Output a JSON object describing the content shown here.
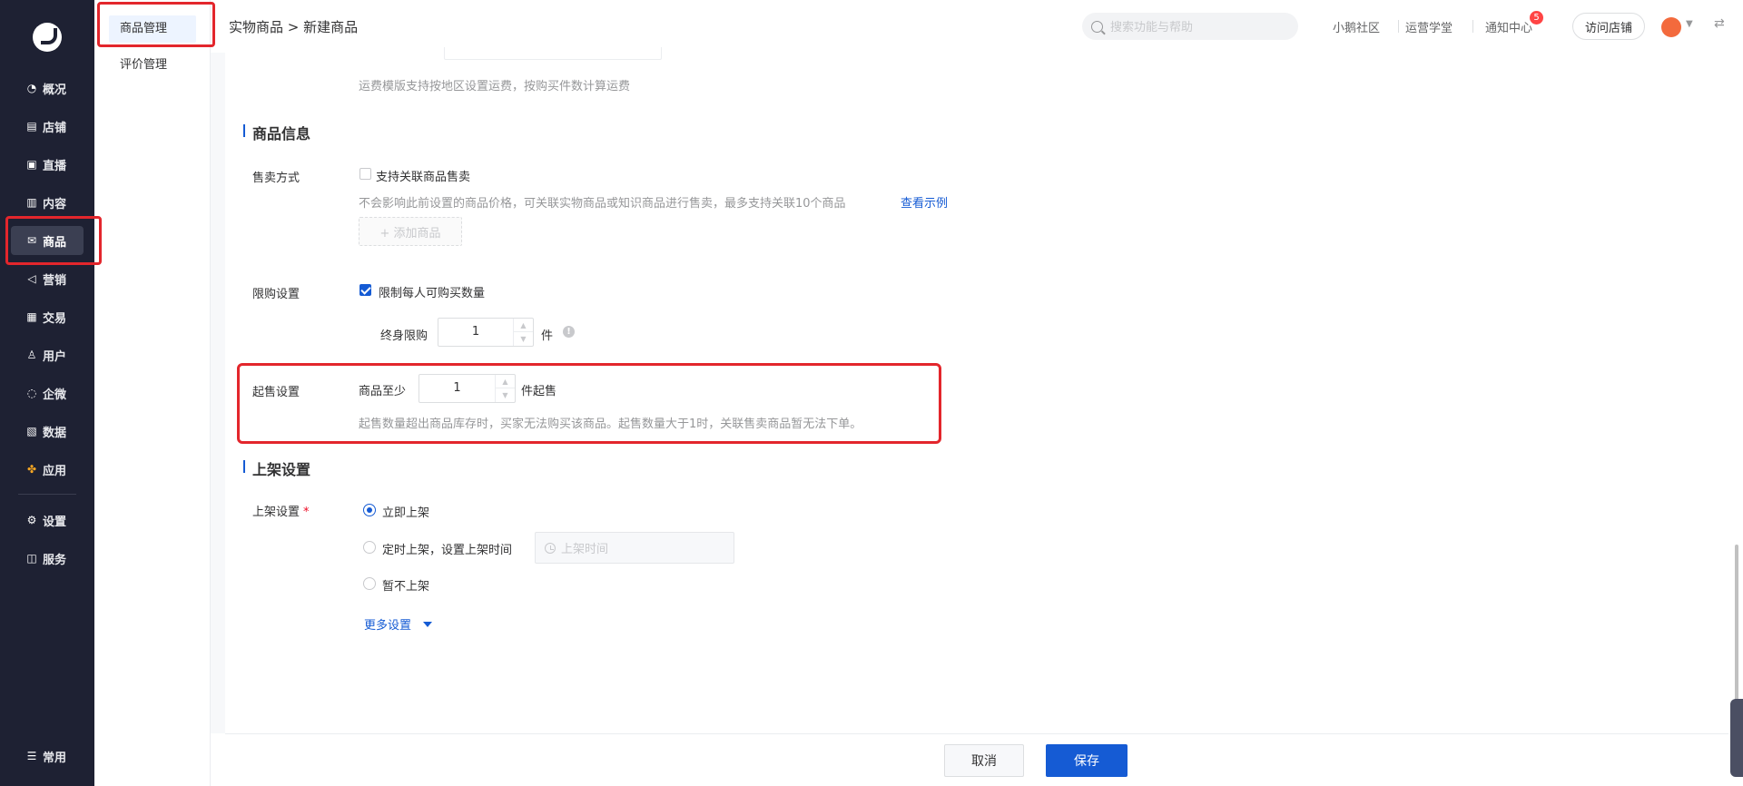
{
  "sidebar": {
    "items": [
      {
        "label": "概况",
        "icon": "pie-chart-icon"
      },
      {
        "label": "店铺",
        "icon": "store-icon"
      },
      {
        "label": "直播",
        "icon": "live-icon"
      },
      {
        "label": "内容",
        "icon": "document-icon"
      },
      {
        "label": "商品",
        "icon": "goods-icon"
      },
      {
        "label": "营销",
        "icon": "megaphone-icon"
      },
      {
        "label": "交易",
        "icon": "transaction-icon"
      },
      {
        "label": "用户",
        "icon": "user-icon"
      },
      {
        "label": "企微",
        "icon": "wecom-icon"
      },
      {
        "label": "数据",
        "icon": "data-icon"
      },
      {
        "label": "应用",
        "icon": "apps-icon"
      },
      {
        "label": "设置",
        "icon": "gear-icon"
      },
      {
        "label": "服务",
        "icon": "service-icon"
      },
      {
        "label": "常用",
        "icon": "list-icon"
      }
    ],
    "active": "商品"
  },
  "submenu": {
    "items": [
      {
        "label": "商品管理"
      },
      {
        "label": "评价管理"
      }
    ]
  },
  "header": {
    "breadcrumb": "实物商品 > 新建商品",
    "search_placeholder": "搜索功能与帮助",
    "links": {
      "community": "小鹅社区",
      "academy": "运营学堂",
      "notifications": "通知中心"
    },
    "notification_count": "5",
    "visit_store": "访问店铺"
  },
  "form": {
    "shipping_help": "运费模版支持按地区设置运费，按购买件数计算运费",
    "product_info": {
      "title": "商品信息",
      "sale_method": {
        "label": "售卖方式",
        "checkbox_label": "支持关联商品售卖",
        "checked": false,
        "help": "不会影响此前设置的商品价格，可关联实物商品或知识商品进行售卖，最多支持关联10个商品",
        "example_link": "查看示例",
        "add_button": "+ 添加商品"
      },
      "purchase_limit": {
        "label": "限购设置",
        "checkbox_label": "限制每人可购买数量",
        "checked": true,
        "lifetime_label": "终身限购",
        "lifetime_value": "1",
        "unit": "件"
      },
      "min_purchase": {
        "label": "起售设置",
        "prefix": "商品至少",
        "value": "1",
        "suffix": "件起售",
        "help": "起售数量超出商品库存时，买家无法购买该商品。起售数量大于1时，关联售卖商品暂无法下单。"
      }
    },
    "listing": {
      "title": "上架设置",
      "label": "上架设置",
      "required_mark": "*",
      "options": [
        {
          "label": "立即上架",
          "selected": true
        },
        {
          "label": "定时上架，设置上架时间",
          "selected": false
        },
        {
          "label": "暂不上架",
          "selected": false
        }
      ],
      "time_placeholder": "上架时间",
      "more_settings": "更多设置"
    }
  },
  "footer": {
    "cancel": "取消",
    "save": "保存"
  },
  "colors": {
    "sidebar_bg": "#1e2133",
    "primary": "#155bd4",
    "highlight_red": "#e3262c",
    "badge_red": "#ff4444"
  }
}
